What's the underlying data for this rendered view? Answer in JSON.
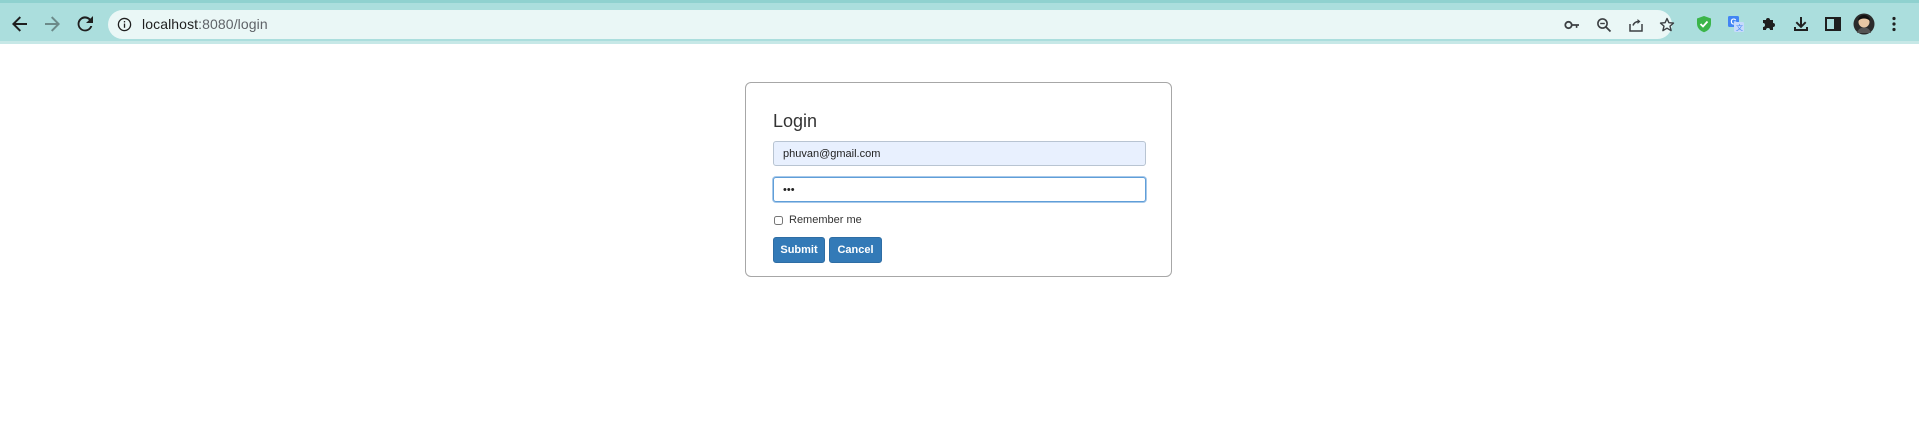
{
  "browser": {
    "url_host": "localhost",
    "url_path": ":8080/login",
    "colors": {
      "chrome": "#abdedd",
      "omnibox": "#eaf7f6"
    },
    "nav_icons": [
      "back-arrow-icon",
      "forward-arrow-icon",
      "reload-icon"
    ],
    "omnibox_icons": [
      "key-icon",
      "zoom-icon",
      "share-icon",
      "star-icon"
    ],
    "toolbar_icons": [
      "shield-extension-icon",
      "translate-extension-icon",
      "puzzle-icon",
      "download-icon",
      "side-panel-icon",
      "profile-avatar",
      "kebab-menu-icon"
    ]
  },
  "login": {
    "title": "Login",
    "email_value": "phuvan@gmail.com",
    "password_value": "•••",
    "remember_label": "Remember me",
    "remember_checked": false,
    "submit_label": "Submit",
    "cancel_label": "Cancel",
    "colors": {
      "button": "#337ab7",
      "email_bg": "#e8f0fe",
      "focus_border": "#5f9ed8"
    }
  }
}
